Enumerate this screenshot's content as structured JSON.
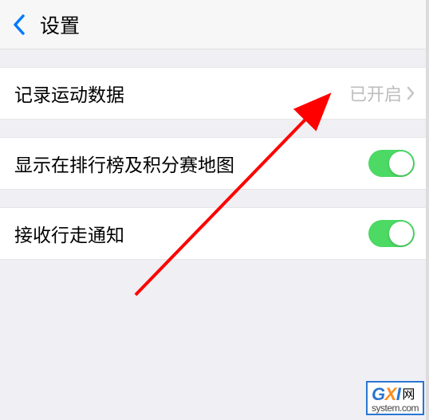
{
  "header": {
    "title": "设置"
  },
  "rows": {
    "record": {
      "label": "记录运动数据",
      "value": "已开启"
    },
    "leaderboard": {
      "label": "显示在排行榜及积分赛地图"
    },
    "walknotify": {
      "label": "接收行走通知"
    }
  },
  "watermark": {
    "line1_wang": "网",
    "line2": "system.com"
  }
}
